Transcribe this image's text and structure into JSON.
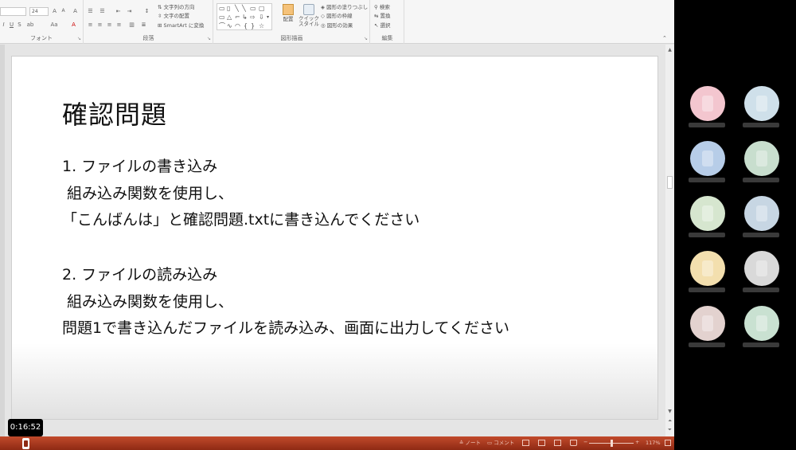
{
  "ribbon": {
    "font": {
      "size_value": "24",
      "grow_label": "A",
      "shrink_label": "A",
      "clear_format_label": "A",
      "bold_label": "I",
      "underline_label": "U",
      "strike_label": "S",
      "spacing_label": "ab",
      "case_label": "Aa",
      "color_label": "A",
      "group_label": "フォント"
    },
    "paragraph": {
      "text_direction_label": "文字列の方向",
      "align_text_label": "文字の配置",
      "smartart_label": "SmartArt に変換",
      "group_label": "段落"
    },
    "drawing": {
      "arrange_label": "配置",
      "quick_style_label": "クイック スタイル",
      "fill_label": "図形の塗りつぶし",
      "outline_label": "図形の枠線",
      "effects_label": "図形の効果",
      "group_label": "図形描画"
    },
    "editing": {
      "find_label": "検索",
      "replace_label": "置換",
      "select_label": "選択",
      "group_label": "編集"
    }
  },
  "slide": {
    "title": "確認問題",
    "lines": [
      "1. ファイルの書き込み",
      " 組み込み関数を使用し、",
      "「こんばんは」と確認問題.txtに書き込んでください",
      "2. ファイルの読み込み",
      " 組み込み関数を使用し、",
      "問題1で書き込んだファイルを読み込み、画面に出力してください"
    ]
  },
  "video": {
    "timestamp": "0:16:52"
  },
  "statusbar": {
    "notes_label": "ノート",
    "comments_label": "コメント",
    "zoom_minus": "−",
    "zoom_plus": "+",
    "zoom_value": "117%"
  },
  "participants": {
    "colors": [
      "#f3c6cf",
      "#cfe0ea",
      "#b7cde8",
      "#c8dece",
      "#d6e6cf",
      "#c7d6e3",
      "#f3dfae",
      "#d9d9d9",
      "#e3d2cf",
      "#c9e1d1"
    ]
  }
}
